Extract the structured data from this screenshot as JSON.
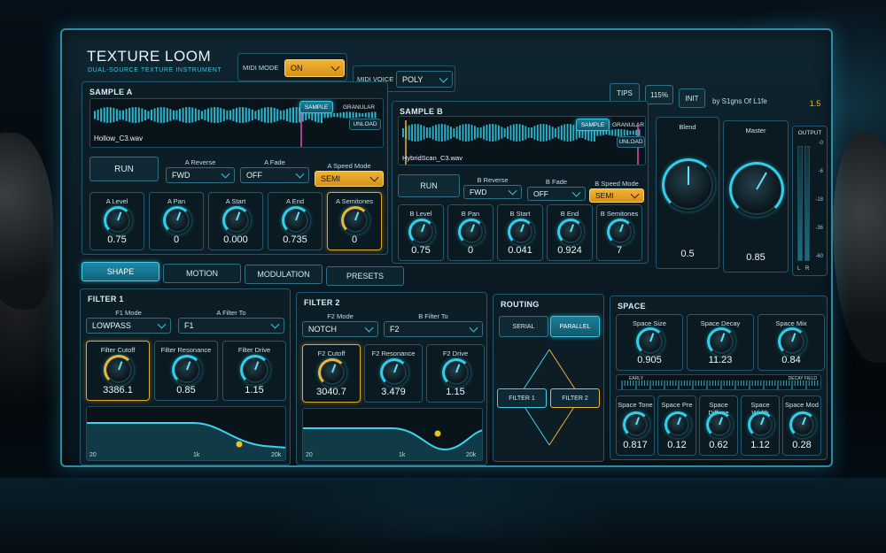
{
  "header": {
    "title": "TEXTURE LOOM",
    "subtitle": "DUAL-SOURCE TEXTURE INSTRUMENT",
    "midi_mode_label": "MIDI MODE",
    "midi_mode_value": "ON",
    "midi_voice_label": "MIDI VOICE",
    "midi_voice_value": "POLY",
    "tips": "TIPS",
    "zoom": "115%",
    "init": "INIT",
    "author": "by S1gns Of L1fe",
    "version": "1.5"
  },
  "sample_a": {
    "title": "SAMPLE A",
    "mode_sample": "SAMPLE",
    "mode_granular": "GRANULAR",
    "unload": "UNLOAD",
    "file": "Hollow_C3.wav",
    "run": "RUN",
    "reverse_label": "A Reverse",
    "reverse_value": "FWD",
    "fade_label": "A Fade",
    "fade_value": "OFF",
    "speed_label": "A Speed Mode",
    "speed_value": "SEMI",
    "knobs": [
      {
        "label": "A Level",
        "value": "0.75"
      },
      {
        "label": "A Pan",
        "value": "0"
      },
      {
        "label": "A Start",
        "value": "0.000"
      },
      {
        "label": "A End",
        "value": "0.735"
      },
      {
        "label": "A Semitones",
        "value": "0"
      }
    ]
  },
  "sample_b": {
    "title": "SAMPLE B",
    "mode_sample": "SAMPLE",
    "mode_granular": "GRANULAR",
    "unload": "UNLOAD",
    "file": "HybridScan_C3.wav",
    "run": "RUN",
    "reverse_label": "B Reverse",
    "reverse_value": "FWD",
    "fade_label": "B Fade",
    "fade_value": "OFF",
    "speed_label": "B Speed Mode",
    "speed_value": "SEMI",
    "knobs": [
      {
        "label": "B Level",
        "value": "0.75"
      },
      {
        "label": "B Pan",
        "value": "0"
      },
      {
        "label": "B Start",
        "value": "0.041"
      },
      {
        "label": "B End",
        "value": "0.924"
      },
      {
        "label": "B Semitones",
        "value": "7"
      }
    ]
  },
  "blend": {
    "label": "Blend",
    "value": "0.5"
  },
  "master": {
    "label": "Master",
    "value": "0.85"
  },
  "output": {
    "label": "OUTPUT",
    "scale": [
      "-0",
      "-6",
      "-18",
      "-36",
      "-60"
    ],
    "channels": [
      "L",
      "R"
    ]
  },
  "tabs": [
    "SHAPE",
    "MOTION",
    "MODULATION",
    "PRESETS"
  ],
  "filter1": {
    "title": "FILTER 1",
    "mode_label": "F1 Mode",
    "mode_value": "LOWPASS",
    "route_label": "A Filter To",
    "route_value": "F1",
    "knobs": [
      {
        "label": "Filter Cutoff",
        "value": "3386.1"
      },
      {
        "label": "Filter Resonance",
        "value": "0.85"
      },
      {
        "label": "Filter Drive",
        "value": "1.15"
      }
    ],
    "axis": [
      "20",
      "1k",
      "20k"
    ]
  },
  "filter2": {
    "title": "FILTER 2",
    "mode_label": "F2 Mode",
    "mode_value": "NOTCH",
    "route_label": "B Filter To",
    "route_value": "F2",
    "knobs": [
      {
        "label": "F2 Cutoff",
        "value": "3040.7"
      },
      {
        "label": "F2 Resonance",
        "value": "3.479"
      },
      {
        "label": "F2 Drive",
        "value": "1.15"
      }
    ],
    "axis": [
      "20",
      "1k",
      "20k"
    ]
  },
  "routing": {
    "title": "ROUTING",
    "serial": "SERIAL",
    "parallel": "PARALLEL",
    "f1": "FILTER 1",
    "f2": "FILTER 2"
  },
  "space": {
    "title": "SPACE",
    "early": "EARLY",
    "decay_field": "DECAY FIELD",
    "knobs_top": [
      {
        "label": "Space Size",
        "value": "0.905"
      },
      {
        "label": "Space Decay",
        "value": "11.23"
      },
      {
        "label": "Space Mix",
        "value": "0.84"
      }
    ],
    "knobs_bottom": [
      {
        "label": "Space Tone",
        "value": "0.817"
      },
      {
        "label": "Space Pre",
        "value": "0.12"
      },
      {
        "label": "Space Diffuse",
        "value": "0.62"
      },
      {
        "label": "Space Width",
        "value": "1.12"
      },
      {
        "label": "Space Mod",
        "value": "0.28"
      }
    ]
  }
}
